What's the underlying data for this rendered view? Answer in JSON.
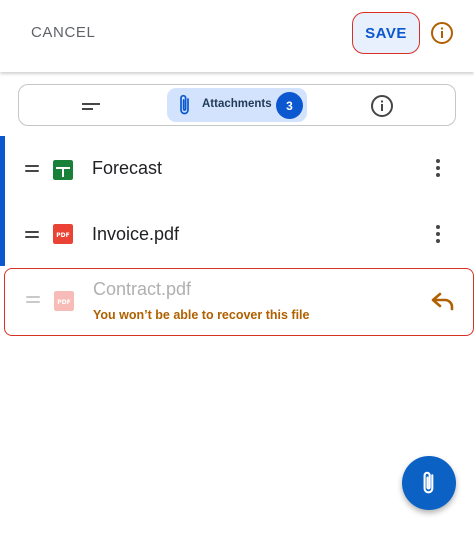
{
  "header": {
    "cancel_label": "CANCEL",
    "save_label": "SAVE"
  },
  "tabs": {
    "attachments_label": "Attachments",
    "attachments_count": "3"
  },
  "attachments": [
    {
      "name": "Forecast",
      "type": "sheet-icon"
    },
    {
      "name": "Invoice.pdf",
      "type": "pdf-icon"
    }
  ],
  "deleted_attachment": {
    "name": "Contract.pdf",
    "type": "pdf-icon",
    "warning": "You won’t be able to recover this file"
  },
  "colors": {
    "accent": "#0b57d0",
    "warning": "#b06000",
    "error_outline": "#d93025",
    "sheets_green": "#188038",
    "pdf_red": "#ea4335"
  }
}
